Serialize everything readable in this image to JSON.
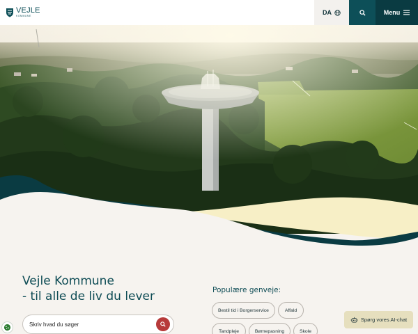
{
  "header": {
    "logo_text": "VEJLE",
    "logo_subtext": "KOMMUNE",
    "language_label": "DA",
    "menu_label": "Menu"
  },
  "hero": {
    "pause_icon": "pause-icon"
  },
  "intro": {
    "title_line1": "Vejle Kommune",
    "title_line2": "- til alle de liv du lever"
  },
  "search": {
    "placeholder": "Skriv hvad du søger"
  },
  "shortcuts": {
    "title": "Populære genveje:",
    "items": [
      "Bestil tid i Borgerservice",
      "Affald",
      "Tandpleje",
      "Børnepasning",
      "Skole"
    ]
  },
  "ai_chat": {
    "label": "Spørg vores AI-chat"
  },
  "colors": {
    "brand_dark": "#0a3b42",
    "brand": "#0d4f58",
    "search_accent": "#b73a3a",
    "wave_yellow": "#f7efc6",
    "background": "#f6f3ef"
  }
}
